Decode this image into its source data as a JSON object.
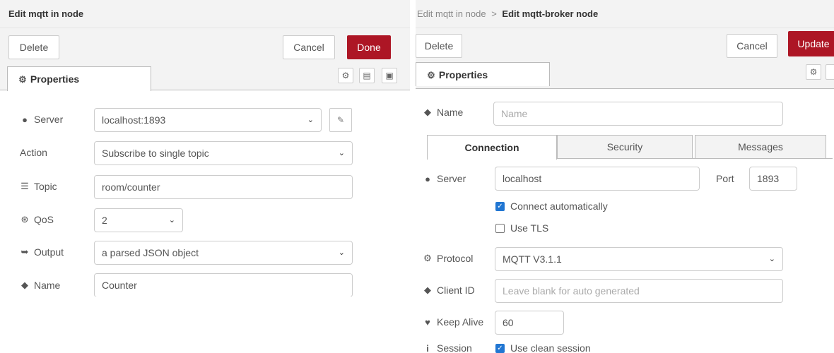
{
  "left": {
    "title": "Edit mqtt in node",
    "delete_label": "Delete",
    "cancel_label": "Cancel",
    "done_label": "Done",
    "properties_tab": "Properties",
    "server_label": "Server",
    "server_value": "localhost:1893",
    "action_label": "Action",
    "action_value": "Subscribe to single topic",
    "topic_label": "Topic",
    "topic_value": "room/counter",
    "qos_label": "QoS",
    "qos_value": "2",
    "output_label": "Output",
    "output_value": "a parsed JSON object",
    "name_label": "Name",
    "name_value": "Counter"
  },
  "right": {
    "breadcrumb_parent": "Edit mqtt in node",
    "breadcrumb_sep": ">",
    "breadcrumb_current": "Edit mqtt-broker node",
    "delete_label": "Delete",
    "cancel_label": "Cancel",
    "update_label": "Update",
    "properties_tab": "Properties",
    "name_label": "Name",
    "name_placeholder": "Name",
    "tabs": [
      "Connection",
      "Security",
      "Messages"
    ],
    "server_label": "Server",
    "server_value": "localhost",
    "port_label": "Port",
    "port_value": "1893",
    "connect_auto_label": "Connect automatically",
    "connect_auto_checked": true,
    "use_tls_label": "Use TLS",
    "use_tls_checked": false,
    "protocol_label": "Protocol",
    "protocol_value": "MQTT V3.1.1",
    "client_id_label": "Client ID",
    "client_id_placeholder": "Leave blank for auto generated",
    "keep_alive_label": "Keep Alive",
    "keep_alive_value": "60",
    "session_label": "Session",
    "clean_session_label": "Use clean session",
    "clean_session_checked": true
  },
  "colors": {
    "primary": "#ad1625",
    "checkbox": "#2176d2",
    "chrome": "#f3f3f3"
  },
  "icons": [
    "gear-icon",
    "globe-icon",
    "list-icon",
    "qos-icon",
    "output-icon",
    "tag-icon",
    "heart-icon",
    "info-icon",
    "pencil-icon",
    "chevron-down-icon",
    "description-icon",
    "appearance-icon"
  ]
}
